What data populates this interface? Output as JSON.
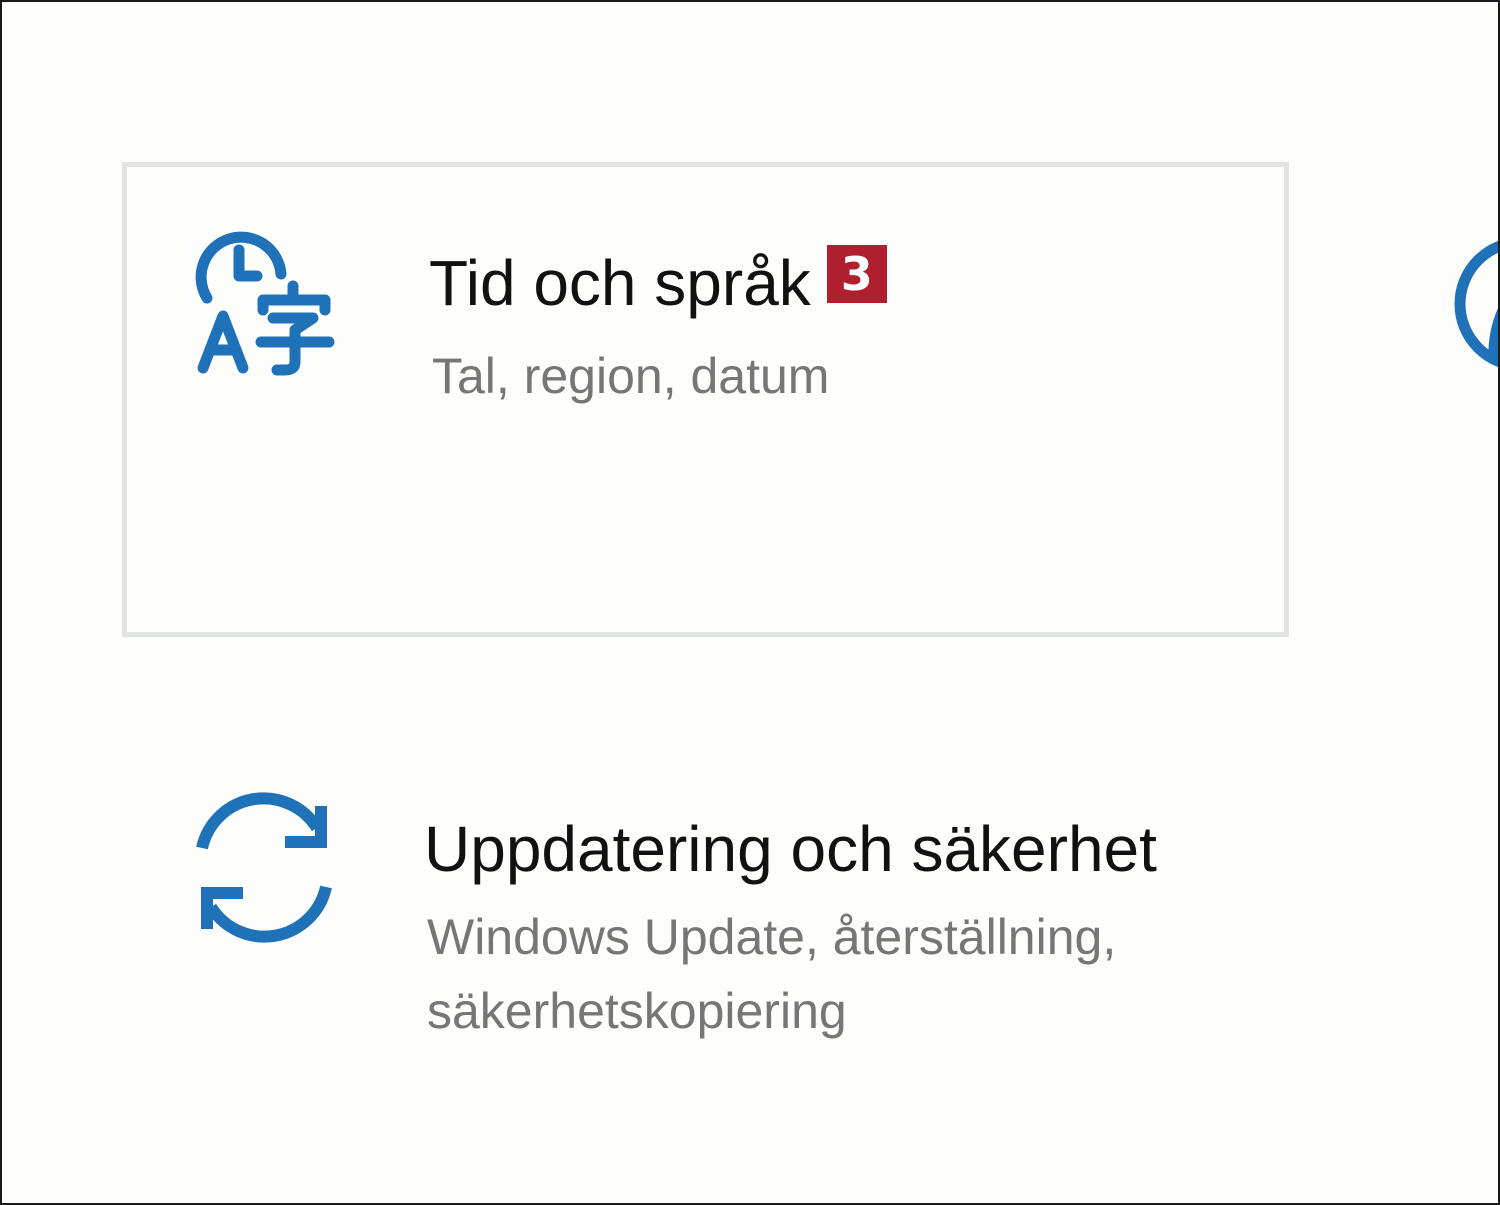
{
  "tiles": {
    "time_language": {
      "icon": "time-language-icon",
      "title": "Tid och språk",
      "badge": "3",
      "subtitle": "Tal, region, datum"
    },
    "update_security": {
      "icon": "sync-arrows-icon",
      "title": "Uppdatering och säkerhet",
      "subtitle_line1": "Windows Update, återställning,",
      "subtitle_line2": "säkerhetskopiering"
    }
  },
  "edge_partial_icon": "xbox-icon",
  "colors": {
    "accent": "#1f72b8",
    "badge": "#b01f2e",
    "tile_border": "#e2e4e1",
    "title_text": "#111111",
    "subtitle_text": "#767676",
    "background": "#fdfdfb"
  }
}
